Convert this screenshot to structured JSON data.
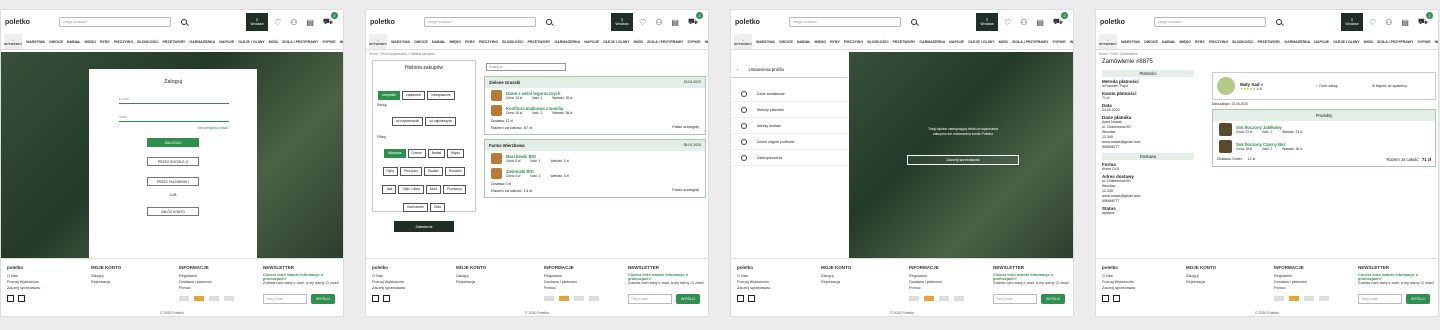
{
  "header": {
    "logo": "poletko",
    "search_placeholder": "czego szukasz?",
    "location": "Wrocław",
    "cart_count": "2",
    "wytworcy": "WYTWÓRCY"
  },
  "categories": [
    "WARZYWA",
    "OWOCE",
    "NABIAŁ",
    "MIĘSO",
    "RYBY",
    "PIECZYWO",
    "SŁODKOŚCI",
    "PRZETWORY",
    "GARMAŻERKA",
    "NAPOJE",
    "OLEJE I OLIWY",
    "MIÓD",
    "ZIOŁA I PRZYPRAWY",
    "SYPKIE",
    "INNE"
  ],
  "footer": {
    "logo": "poletko",
    "col1": [
      "O Nas",
      "Poznaj Wytwórców",
      "Zacznij sprzedawać"
    ],
    "moje_konto_title": "MOJE KONTO",
    "moje_konto": [
      "Zaloguj",
      "Rejestracja"
    ],
    "informacje_title": "INFORMACJE",
    "informacje": [
      "Regulamin",
      "Dostawa i płatności",
      "Pomoc"
    ],
    "newsletter_title": "NEWSLETTER",
    "newsletter_text": "Chcesz mieć świeże informacje o promocjach?",
    "newsletter_text2": "Zostaw nam swój e-mail, a my damy Ci znać!",
    "email_placeholder": "Twój e-mail",
    "send": "WYŚLIJ",
    "copyright": "© 2020 Poletko"
  },
  "login": {
    "title": "Zaloguj",
    "email": "e-mail",
    "password": "hasło",
    "forgot": "Nie pamiętasz hasła?",
    "submit": "ZALOGUJ",
    "google": "PRZEZ GOOGLE",
    "facebook": "PRZEZ FACEBOOK",
    "or": "LUB",
    "register": "ZAŁÓŻ KONTO"
  },
  "history": {
    "breadcrumb": "Home > Profil użytkownika > Historia zakupów",
    "title": "Historia zakupów",
    "status": [
      "wszystkie",
      "zapłacone",
      "niezapłacone"
    ],
    "sort_label": "Sortuj",
    "sort": [
      "od najnowszych",
      "od najstarszych"
    ],
    "filter_label": "Filtruj",
    "filters": [
      "Warzywa",
      "Owoce",
      "Nabiał",
      "Mięso",
      "Ryby",
      "Pieczywo",
      "Słodkie",
      "Rosoniki",
      "Jaja",
      "Oleje i oliwy",
      "Miód",
      "Przetwory",
      "Garmażerki",
      "Zioła"
    ],
    "apply": "Zatwierdź",
    "search_placeholder": "Szukaj w...",
    "orders": [
      {
        "shop": "Zielone Gruszki",
        "date": "15.04.2020",
        "items": [
          {
            "name": "Dżem z wiśni tegorocznych",
            "cena": "Cena: 13 zł",
            "ilosc": "Ilość: 1",
            "wartosc": "Wartość: 35 zł"
          },
          {
            "name": "Konfitura malinowa z wanilią",
            "cena": "Cena: 18 zł",
            "ilosc": "Ilość: 2",
            "wartosc": "Wartość: 36 zł"
          }
        ],
        "delivery": "Dostawa: 12 zł",
        "total": "Razem za całość: 87 zł",
        "details": "Pokaż szczegóły"
      },
      {
        "shop": "Farma Wierzbowa",
        "date": "08.04.2020",
        "items": [
          {
            "name": "Marchewki BIO",
            "cena": "Cena: 5 zł",
            "ilosc": "Ilość: 1",
            "wartosc": "Wartość: 5 zł"
          },
          {
            "name": "Ziemniaki BIO",
            "cena": "Cena: 4 zł",
            "ilosc": "Ilość: 2",
            "wartosc": "Wartość: 8 zł"
          }
        ],
        "delivery": "Dostawa: 0 zł",
        "total": "Razem za całość: 13 zł",
        "details": "Pokaż szczegóły"
      }
    ]
  },
  "settings": {
    "title": "Ustawienia profilu",
    "items": [
      "Dane kontaktowe",
      "Metody płatności",
      "Adresy dostaw",
      "Zmień zdjęcie profilowe",
      "Zabezpieczenia"
    ],
    "message": "Tutaj będzie zachęcający tekst do wykonania zakupów lub zobaczenia konta Poletko",
    "cta": "Zacznij sprzedawać"
  },
  "order": {
    "title": "Zamówienie #8875",
    "platnosci": "Płatności",
    "metoda_label": "Metoda płatności",
    "metoda": "mTransfer, PayU",
    "kwota_label": "Kwota płatności",
    "kwota": "71 zł",
    "data_label": "Data",
    "data": "24.03.2020",
    "dane_label": "Dane płatnika",
    "dane": [
      "Anna Nowak",
      "ul. Chabertowa 50",
      "Wrocław",
      "12-345",
      "anna.nowak@gmail.com",
      "555666777"
    ],
    "dostawa": "Dostawa",
    "forma_label": "Forma",
    "forma": "Kurier DLS",
    "adres_label": "Adres dostawy",
    "adres": [
      "ul. Chabertowa 50",
      "Wrocław",
      "12-345",
      "anna.nowak@gmail.com",
      "555666777"
    ],
    "status_label": "Status",
    "status": "wysłane",
    "shop": "Mały Sad",
    "rating": "4.8",
    "rate_btn": "Oceń zakup",
    "msg_btn": "Napisz do wytwórcy",
    "data_zakupu": "Data zakupu: 23.05.2020",
    "produkty": "Produkty",
    "items": [
      {
        "name": "Sok tłoczony Jabłkowy",
        "cena": "Cena: 23 zł",
        "ilosc": "Ilość: 1",
        "wartosc": "Wartość: 23 zł"
      },
      {
        "name": "Sok tłoczony Czarny Bez",
        "cena": "Cena: 18 zł",
        "ilosc": "Ilość: 2",
        "wartosc": "Wartość: 36 zł"
      }
    ],
    "dostawa_kurier": "Dostawa: Kurier",
    "dostawa_cena": "12 zł",
    "total": "Razem za całość:",
    "total_val": "71 zł"
  }
}
